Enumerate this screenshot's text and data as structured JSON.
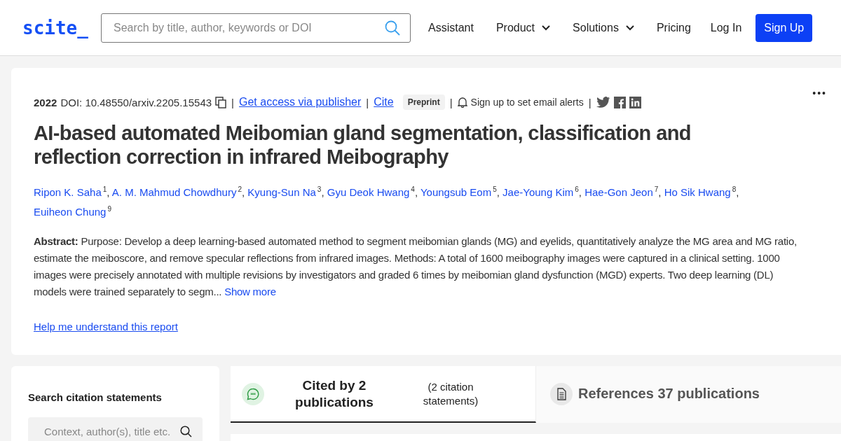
{
  "header": {
    "logo": "scite_",
    "search": {
      "placeholder": "Search by title, author, keywords or DOI"
    },
    "nav": [
      {
        "label": "Assistant",
        "dropdown": false
      },
      {
        "label": "Product",
        "dropdown": true
      },
      {
        "label": "Solutions",
        "dropdown": true
      },
      {
        "label": "Pricing",
        "dropdown": false
      },
      {
        "label": "Log In",
        "dropdown": false
      }
    ],
    "signup": "Sign Up"
  },
  "paper": {
    "year": "2022",
    "doi": "DOI: 10.48550/arxiv.2205.15543",
    "sep": "|",
    "access": "Get access via publisher",
    "cite": "Cite",
    "badge": "Preprint",
    "alerts": "Sign up to set email alerts",
    "more": "•••",
    "author_sep": ", ",
    "title": "AI-based automated Meibomian gland segmentation, classification and reflection correction in infrared Meibography",
    "authors": [
      {
        "name": "Ripon K. Saha",
        "sup": "1"
      },
      {
        "name": "A. M. Mahmud Chowdhury",
        "sup": "2"
      },
      {
        "name": "Kyung-Sun Na",
        "sup": "3"
      },
      {
        "name": "Gyu Deok Hwang",
        "sup": "4"
      },
      {
        "name": "Youngsub Eom",
        "sup": "5"
      },
      {
        "name": "Jae-Young Kim",
        "sup": "6"
      },
      {
        "name": "Hae-Gon Jeon",
        "sup": "7"
      },
      {
        "name": "Ho Sik Hwang",
        "sup": "8"
      },
      {
        "name": "Euiheon Chung",
        "sup": "9"
      }
    ],
    "abstract_label": "Abstract:",
    "abstract": "Purpose: Develop a deep learning-based automated method to segment meibomian glands (MG) and eyelids, quantitatively analyze the MG area and MG ratio, estimate the meiboscore, and remove specular reflections from infrared images. Methods: A total of 1600 meibography images were captured in a clinical setting. 1000 images were precisely annotated with multiple revisions by investigators and graded 6 times by meibomian gland dysfunction (MGD) experts. Two deep learning (DL) models were trained separately to segm...",
    "show_more": "Show more",
    "help": "Help me understand this report"
  },
  "citations": {
    "heading": "Search citation statements",
    "search": {
      "placeholder": "Context, author(s), title etc."
    }
  },
  "tabs": [
    {
      "kind": "cited",
      "title": "Cited by 2 publications",
      "note": "(2 citation statements)",
      "selected": true
    },
    {
      "kind": "references",
      "title": "References 37 publications",
      "selected": false
    }
  ]
}
